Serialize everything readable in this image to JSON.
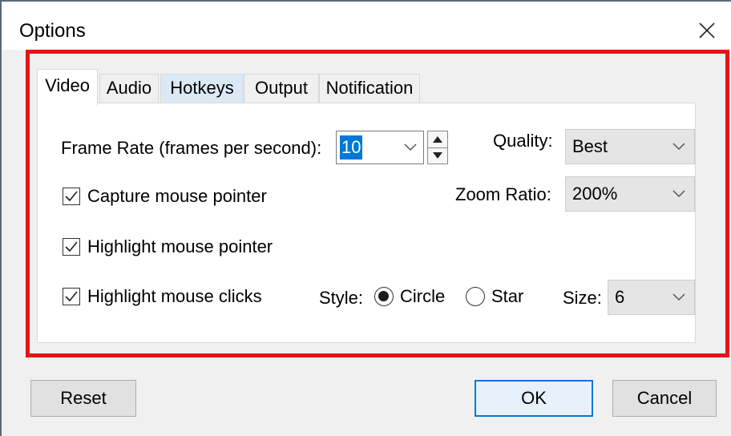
{
  "window": {
    "title": "Options"
  },
  "tabs": [
    {
      "label": "Video",
      "active": true
    },
    {
      "label": "Audio",
      "active": false
    },
    {
      "label": "Hotkeys",
      "active": false
    },
    {
      "label": "Output",
      "active": false
    },
    {
      "label": "Notification",
      "active": false
    }
  ],
  "video": {
    "frame_rate_label": "Frame Rate (frames per second):",
    "frame_rate_value": "10",
    "quality_label": "Quality:",
    "quality_value": "Best",
    "zoom_label": "Zoom Ratio:",
    "zoom_value": "200%",
    "capture_pointer_label": "Capture mouse pointer",
    "capture_pointer_checked": true,
    "highlight_pointer_label": "Highlight mouse pointer",
    "highlight_pointer_checked": true,
    "highlight_clicks_label": "Highlight mouse clicks",
    "highlight_clicks_checked": true,
    "style_label": "Style:",
    "style_options": [
      "Circle",
      "Star"
    ],
    "style_selected": "Circle",
    "size_label": "Size:",
    "size_value": "6"
  },
  "buttons": {
    "reset": "Reset",
    "ok": "OK",
    "cancel": "Cancel"
  },
  "colors": {
    "highlight_border": "#e8121a",
    "selection": "#0078d7",
    "tab_hover": "#dbe8f5"
  }
}
